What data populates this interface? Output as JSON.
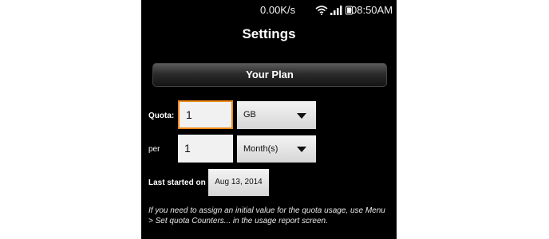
{
  "status_bar": {
    "network_speed": "0.00K/s",
    "time": "08:50AM",
    "icons": [
      "wifi-icon",
      "signal-icon",
      "battery-icon"
    ]
  },
  "screen": {
    "title": "Settings"
  },
  "plan": {
    "header": "Your Plan",
    "quota_label": "Quota:",
    "quota_value": "1",
    "quota_unit": "GB",
    "per_label": "per",
    "per_value": "1",
    "per_unit": "Month(s)",
    "last_started_label": "Last started on",
    "last_started_date": "Aug 13, 2014"
  },
  "help_text": "If you need to assign an initial value for the quota usage, use Menu > Set quota Counters... in the usage report screen.",
  "colors": {
    "focus_border": "#f08a1a",
    "background": "#000000"
  }
}
